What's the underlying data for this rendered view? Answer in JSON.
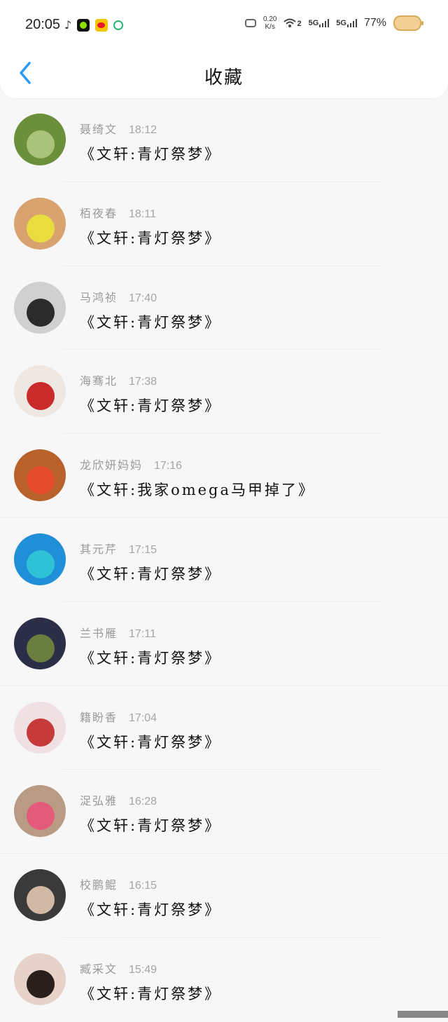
{
  "status_bar": {
    "time": "20:05",
    "speed_value": "0.20",
    "speed_unit": "K/s",
    "wifi_label": "2",
    "signal1": "5G",
    "signal2": "5G",
    "battery": "77%"
  },
  "header": {
    "title": "收藏"
  },
  "items": [
    {
      "name": "聂绮文",
      "time": "18:12",
      "message": "《文轩:青灯祭梦》",
      "avatar_colors": [
        "#6b8f3a",
        "#a9c47a"
      ]
    },
    {
      "name": "栢夜春",
      "time": "18:11",
      "message": "《文轩:青灯祭梦》",
      "avatar_colors": [
        "#d9a36f",
        "#e8dc3e"
      ]
    },
    {
      "name": "马鸿祯",
      "time": "17:40",
      "message": "《文轩:青灯祭梦》",
      "avatar_colors": [
        "#cfd0cf",
        "#2b2b2b"
      ]
    },
    {
      "name": "海骞北",
      "time": "17:38",
      "message": "《文轩:青灯祭梦》",
      "avatar_colors": [
        "#efe7e2",
        "#c92b2b"
      ]
    },
    {
      "name": "龙欣妍妈妈",
      "time": "17:16",
      "message": "《文轩:我家omega马甲掉了》",
      "avatar_colors": [
        "#b8612a",
        "#e44b2c"
      ]
    },
    {
      "name": "其元芹",
      "time": "17:15",
      "message": "《文轩:青灯祭梦》",
      "avatar_colors": [
        "#1f8fd8",
        "#2fc2d6"
      ]
    },
    {
      "name": "兰书雁",
      "time": "17:11",
      "message": "《文轩:青灯祭梦》",
      "avatar_colors": [
        "#2c2e47",
        "#6a7f3f"
      ]
    },
    {
      "name": "籍盼香",
      "time": "17:04",
      "message": "《文轩:青灯祭梦》",
      "avatar_colors": [
        "#f0dfe3",
        "#c73a3a"
      ]
    },
    {
      "name": "浞弘雅",
      "time": "16:28",
      "message": "《文轩:青灯祭梦》",
      "avatar_colors": [
        "#b99a84",
        "#e45a7a"
      ]
    },
    {
      "name": "校鹏鲲",
      "time": "16:15",
      "message": "《文轩:青灯祭梦》",
      "avatar_colors": [
        "#3a3a3a",
        "#d2b9a6"
      ]
    },
    {
      "name": "臧采文",
      "time": "15:49",
      "message": "《文轩:青灯祭梦》",
      "avatar_colors": [
        "#e6d2c8",
        "#2a1f1a"
      ]
    }
  ]
}
